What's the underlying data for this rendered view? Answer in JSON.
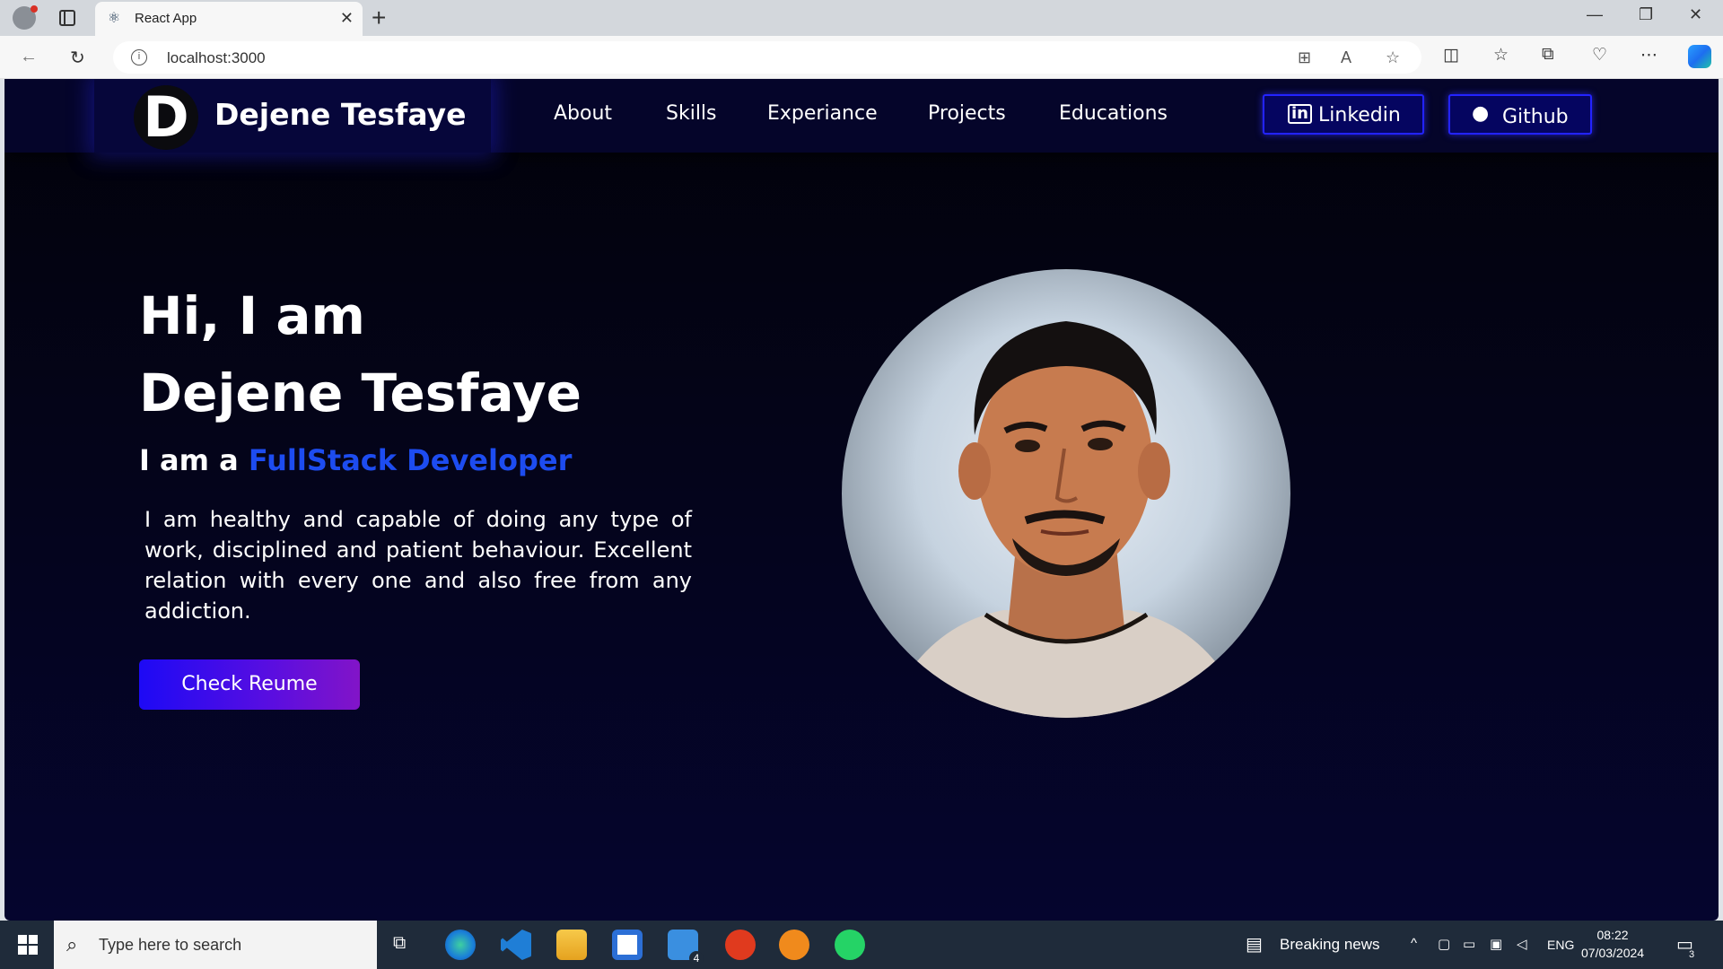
{
  "browser": {
    "tab_title": "React App",
    "url": "localhost:3000",
    "new_tab_symbol": "+"
  },
  "site": {
    "brand_initial": "D",
    "brand_name": "Dejene Tesfaye",
    "nav": {
      "about": "About",
      "skills": "Skills",
      "experience": "Experiance",
      "projects": "Projects",
      "educations": "Educations"
    },
    "social": {
      "linkedin": "Linkedin",
      "github": "Github"
    }
  },
  "hero": {
    "greeting": "Hi, I am",
    "name": "Dejene Tesfaye",
    "role_prefix": "I am a",
    "role": "FullStack Developer",
    "description": "I am healthy and capable of doing any type of work, disciplined and patient behaviour. Excellent relation with every one and also free from any addiction.",
    "button": "Check Reume"
  },
  "taskbar": {
    "search_placeholder": "Type here to search",
    "news": "Breaking news",
    "language": "ENG",
    "time": "08:22",
    "date": "07/03/2024",
    "mail_badge": "4",
    "notifications_badge": "3"
  },
  "colors": {
    "accent_blue": "#1d4cf0",
    "button_start": "#1d0af5",
    "button_end": "#8214c8",
    "nav_bg": "#05052a"
  }
}
